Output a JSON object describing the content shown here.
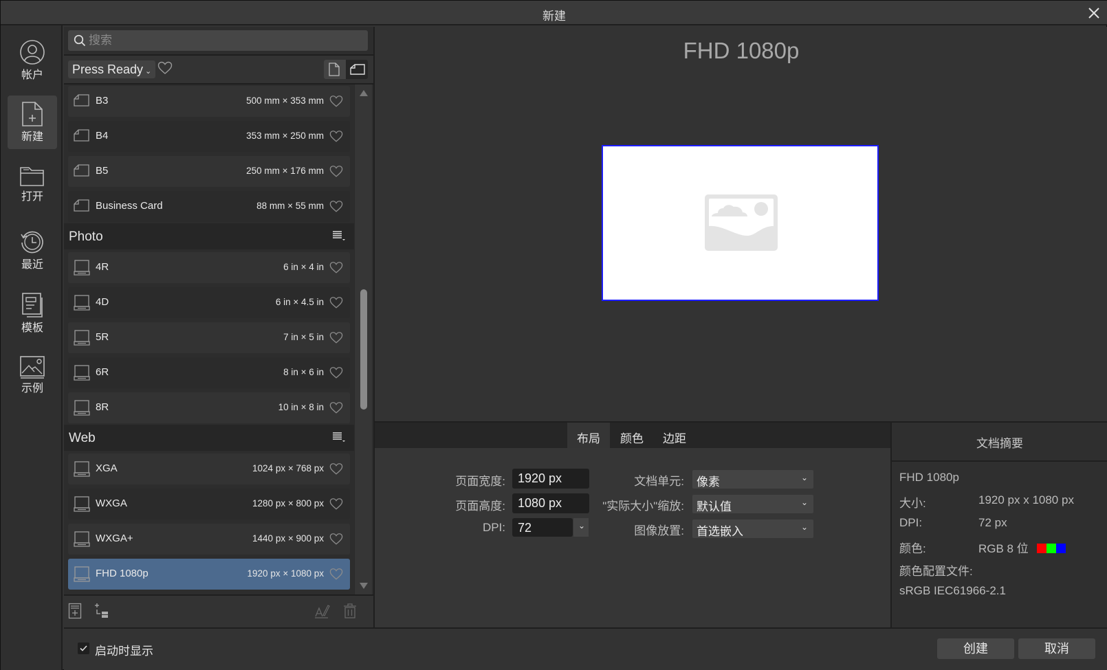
{
  "window": {
    "title": "新建",
    "close_icon": "close-icon"
  },
  "nav": {
    "items": [
      {
        "label": "帐户",
        "icon": "user-icon",
        "active": false
      },
      {
        "label": "新建",
        "icon": "new-document-icon",
        "active": true
      },
      {
        "label": "打开",
        "icon": "folder-icon",
        "active": false
      },
      {
        "label": "最近",
        "icon": "history-icon",
        "active": false
      },
      {
        "label": "模板",
        "icon": "template-icon",
        "active": false
      },
      {
        "label": "示例",
        "icon": "image-icon",
        "active": false
      }
    ]
  },
  "search": {
    "placeholder": "搜索",
    "value": ""
  },
  "filter": {
    "category": "Press Ready",
    "favorites_icon": "heart-icon",
    "orientation": [
      "portrait",
      "landscape"
    ],
    "orientation_selected": "portrait"
  },
  "presets": {
    "top_items": [
      {
        "name": "B3",
        "dims": "500 mm × 353 mm"
      },
      {
        "name": "B4",
        "dims": "353 mm × 250 mm"
      },
      {
        "name": "B5",
        "dims": "250 mm × 176 mm"
      },
      {
        "name": "Business Card",
        "dims": "88 mm × 55 mm"
      }
    ],
    "groups": [
      {
        "name": "Photo",
        "items": [
          {
            "name": "4R",
            "dims": "6 in × 4 in"
          },
          {
            "name": "4D",
            "dims": "6 in × 4.5 in"
          },
          {
            "name": "5R",
            "dims": "7 in × 5 in"
          },
          {
            "name": "6R",
            "dims": "8 in × 6 in"
          },
          {
            "name": "8R",
            "dims": "10 in × 8 in"
          }
        ]
      },
      {
        "name": "Web",
        "items": [
          {
            "name": "XGA",
            "dims": "1024 px × 768 px"
          },
          {
            "name": "WXGA",
            "dims": "1280 px × 800 px"
          },
          {
            "name": "WXGA+",
            "dims": "1440 px × 900 px"
          },
          {
            "name": "FHD 1080p",
            "dims": "1920 px × 1080 px",
            "selected": true
          }
        ]
      }
    ]
  },
  "preview": {
    "title": "FHD 1080p",
    "canvas_border_color": "#1c1cff"
  },
  "tabs": [
    {
      "label": "布局",
      "active": true
    },
    {
      "label": "颜色",
      "active": false
    },
    {
      "label": "边距",
      "active": false
    }
  ],
  "layout": {
    "page_width_label": "页面宽度:",
    "page_width": "1920 px",
    "page_height_label": "页面高度:",
    "page_height": "1080 px",
    "dpi_label": "DPI:",
    "dpi": "72",
    "doc_units_label": "文档单元:",
    "doc_units": "像素",
    "actual_size_label": "\"实际大小\"缩放:",
    "actual_size": "默认值",
    "image_placement_label": "图像放置:",
    "image_placement": "首选嵌入"
  },
  "summary": {
    "heading": "文档摘要",
    "name": "FHD 1080p",
    "size_label": "大小:",
    "size_value": "1920 px  x  1080 px",
    "dpi_label": "DPI:",
    "dpi_value": "72 px",
    "color_label": "颜色:",
    "color_value": "RGB 8 位",
    "color_swatches": [
      "#ff0000",
      "#00ff00",
      "#0000ff"
    ],
    "profile_label": "颜色配置文件:",
    "profile_value": "sRGB IEC61966-2.1"
  },
  "footer": {
    "show_on_startup_label": "启动时显示",
    "show_on_startup": true,
    "create_label": "创建",
    "cancel_label": "取消"
  },
  "colors": {
    "selection": "#4c6a8e",
    "background": "#333333"
  }
}
